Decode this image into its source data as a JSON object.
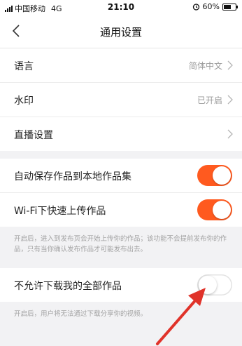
{
  "status_bar": {
    "carrier": "中国移动",
    "network": "4G",
    "time": "21:10",
    "battery": "60%",
    "battery_level": 0.6
  },
  "header": {
    "title": "通用设置",
    "back_icon": "chevron-left-icon"
  },
  "settings_group": [
    {
      "label": "语言",
      "value": "简体中文"
    },
    {
      "label": "水印",
      "value": "已开启"
    },
    {
      "label": "直播设置",
      "value": ""
    }
  ],
  "upload_group": {
    "auto_save_label": "自动保存作品到本地作品集",
    "auto_save_on": true,
    "wifi_upload_label": "Wi-Fi下快速上传作品",
    "wifi_upload_on": true,
    "note": "开启后，进入到发布页会开始上传你的作品；该功能不会提前发布你的作品，只有当你确认发布作品才可能发布出去。"
  },
  "download_group": {
    "label": "不允许下载我的全部作品",
    "on": false,
    "note": "开启后，用户将无法通过下载分享你的视频。"
  },
  "colors": {
    "accent": "#ff5a1f",
    "arrow": "#e0332a",
    "background": "#f2f2f4"
  }
}
